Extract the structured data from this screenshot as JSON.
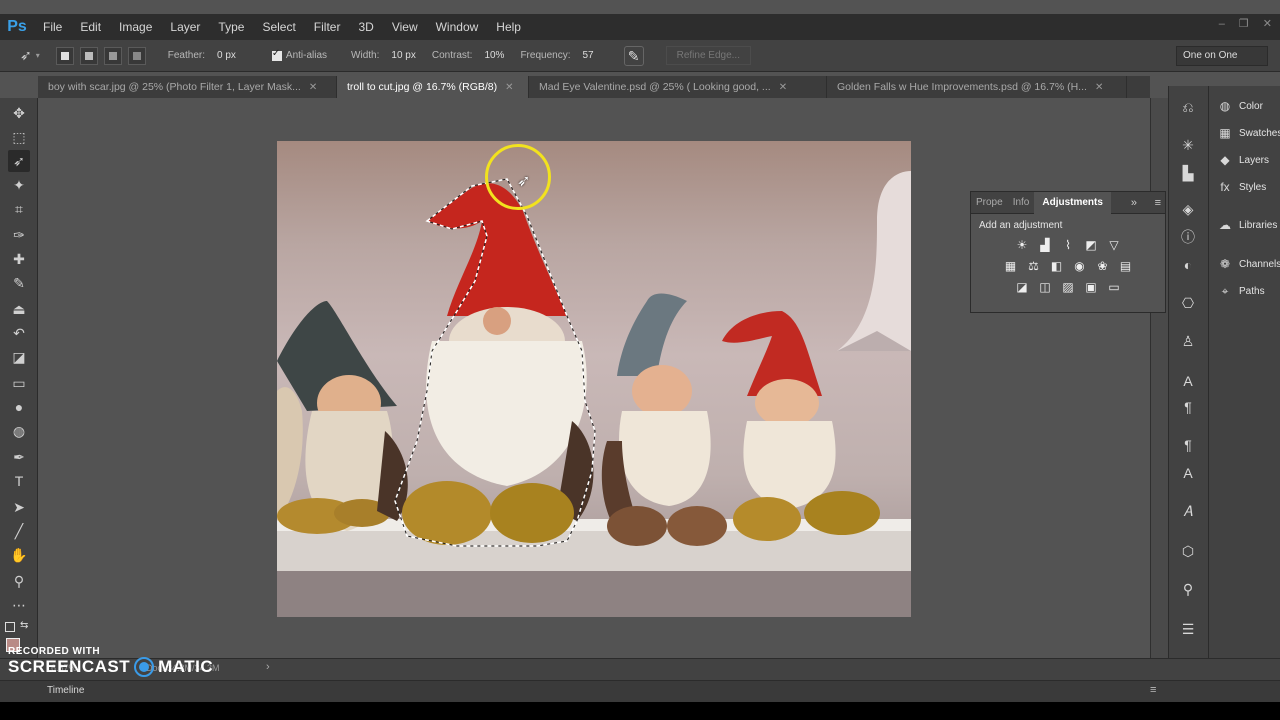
{
  "app": {
    "logo": "Ps"
  },
  "menu": [
    "File",
    "Edit",
    "Image",
    "Layer",
    "Type",
    "Select",
    "Filter",
    "3D",
    "View",
    "Window",
    "Help"
  ],
  "window_controls": [
    "–",
    "❐",
    "✕"
  ],
  "options": {
    "feather_label": "Feather:",
    "feather_value": "0 px",
    "antialias_label": "Anti-alias",
    "width_label": "Width:",
    "width_value": "10 px",
    "contrast_label": "Contrast:",
    "contrast_value": "10%",
    "frequency_label": "Frequency:",
    "frequency_value": "57",
    "refine_edge": "Refine Edge...",
    "workspace": "One on One"
  },
  "tabs": [
    {
      "label": "boy with scar.jpg @ 25% (Photo Filter 1, Layer Mask...",
      "close": "✕"
    },
    {
      "label": "troll to cut.jpg @ 16.7% (RGB/8)",
      "close": "✕"
    },
    {
      "label": "Mad Eye Valentine.psd @ 25% (    Looking good,   ...",
      "close": "✕"
    },
    {
      "label": "Golden Falls w Hue Improvements.psd @ 16.7% (H...",
      "close": "✕"
    }
  ],
  "adjustments": {
    "tabs": [
      "Prope",
      "Info",
      "Adjustments"
    ],
    "subtitle": "Add an adjustment"
  },
  "side_panels": [
    "Color",
    "Swatches",
    "Layers",
    "Styles",
    "Libraries",
    "Channels",
    "Paths"
  ],
  "status": {
    "zoom": "16.67%",
    "doc": "Doc: 34.3M/34.3M"
  },
  "timeline": {
    "label": "Timeline"
  },
  "watermark": {
    "line1": "RECORDED WITH",
    "line2a": "SCREENCAST",
    "line2b": "MATIC"
  },
  "colors": {
    "accent": "#3aa0e8",
    "selection_circle": "#f2e21e"
  }
}
